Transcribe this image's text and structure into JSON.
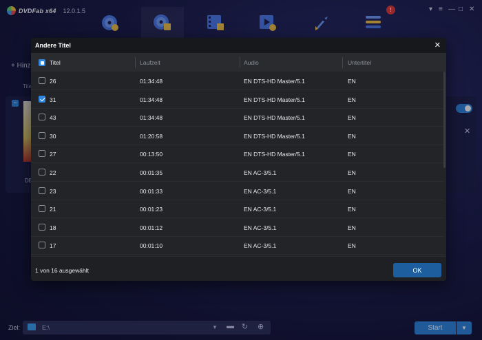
{
  "app": {
    "name": "DVDFab x64",
    "version": "12.0.1.5"
  },
  "topbar": {
    "nav": [
      {
        "name": "copy-icon"
      },
      {
        "name": "ripper-icon"
      },
      {
        "name": "video-converter-icon"
      },
      {
        "name": "creator-icon"
      },
      {
        "name": "utilities-icon"
      },
      {
        "name": "task-queue-icon"
      }
    ],
    "notification_count": "!",
    "window_controls": [
      "▾",
      "≡",
      "—",
      "□",
      "✕"
    ]
  },
  "background": {
    "add_label": "Hinz",
    "title_col": "Titel",
    "disc_label": "DE"
  },
  "bottom": {
    "ziel_label": "Ziel:",
    "path": "E:\\",
    "start_label": "Start"
  },
  "modal": {
    "title": "Andere Titel",
    "close": "✕",
    "columns": [
      "Titel",
      "Laufzeit",
      "Audio",
      "Untertitel"
    ],
    "rows": [
      {
        "title": "26",
        "duration": "01:34:48",
        "audio": "EN  DTS-HD Master/5.1",
        "subtitle": "EN",
        "checked": false
      },
      {
        "title": "31",
        "duration": "01:34:48",
        "audio": "EN  DTS-HD Master/5.1",
        "subtitle": "EN",
        "checked": true
      },
      {
        "title": "43",
        "duration": "01:34:48",
        "audio": "EN  DTS-HD Master/5.1",
        "subtitle": "EN",
        "checked": false
      },
      {
        "title": "30",
        "duration": "01:20:58",
        "audio": "EN  DTS-HD Master/5.1",
        "subtitle": "EN",
        "checked": false
      },
      {
        "title": "27",
        "duration": "00:13:50",
        "audio": "EN  DTS-HD Master/5.1",
        "subtitle": "EN",
        "checked": false
      },
      {
        "title": "22",
        "duration": "00:01:35",
        "audio": "EN  AC-3/5.1",
        "subtitle": "EN",
        "checked": false
      },
      {
        "title": "23",
        "duration": "00:01:33",
        "audio": "EN  AC-3/5.1",
        "subtitle": "EN",
        "checked": false
      },
      {
        "title": "21",
        "duration": "00:01:23",
        "audio": "EN  AC-3/5.1",
        "subtitle": "EN",
        "checked": false
      },
      {
        "title": "18",
        "duration": "00:01:12",
        "audio": "EN  AC-3/5.1",
        "subtitle": "EN",
        "checked": false
      },
      {
        "title": "17",
        "duration": "00:01:10",
        "audio": "EN  AC-3/5.1",
        "subtitle": "EN",
        "checked": false
      }
    ],
    "selection_status": "1 von 16 ausgewählt",
    "ok_label": "OK"
  },
  "colors": {
    "accent": "#2e86de",
    "modal_bg": "#232427",
    "header_bg": "#17181b"
  }
}
